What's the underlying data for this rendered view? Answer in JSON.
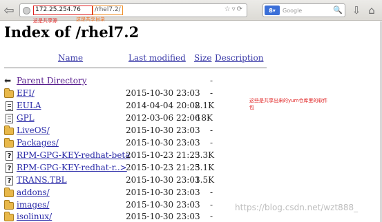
{
  "browser": {
    "url_host": "172.25.254.76",
    "url_path": "/rhel7.2/",
    "search_engine_badge": "8",
    "search_placeholder": "Google"
  },
  "annotations": {
    "host_note": "这是共享源",
    "path_note": "这是共享目录",
    "repo_note": "这些是共享出来的yum仓库里的软件包"
  },
  "page": {
    "title": "Index of /rhel7.2",
    "columns": {
      "name": "Name",
      "last_modified": "Last modified",
      "size": "Size",
      "description": "Description"
    },
    "rows": [
      {
        "icon": "back",
        "name": "Parent Directory",
        "modified": "",
        "size": "-"
      },
      {
        "icon": "folder",
        "name": "EFI/",
        "modified": "2015-10-30 23:03",
        "size": "-"
      },
      {
        "icon": "file",
        "name": "EULA",
        "modified": "2014-04-04 20:02",
        "size": "8.1K"
      },
      {
        "icon": "file",
        "name": "GPL",
        "modified": "2012-03-06 22:06",
        "size": "18K"
      },
      {
        "icon": "folder",
        "name": "LiveOS/",
        "modified": "2015-10-30 23:03",
        "size": "-"
      },
      {
        "icon": "folder",
        "name": "Packages/",
        "modified": "2015-10-30 23:03",
        "size": "-"
      },
      {
        "icon": "unknown",
        "name": "RPM-GPG-KEY-redhat-beta",
        "modified": "2015-10-23 21:25",
        "size": "3.3K"
      },
      {
        "icon": "unknown",
        "name": "RPM-GPG-KEY-redhat-r..>",
        "modified": "2015-10-23 21:25",
        "size": "3.1K"
      },
      {
        "icon": "unknown",
        "name": "TRANS.TBL",
        "modified": "2015-10-30 23:03",
        "size": "1.5K"
      },
      {
        "icon": "folder",
        "name": "addons/",
        "modified": "2015-10-30 23:03",
        "size": "-"
      },
      {
        "icon": "folder",
        "name": "images/",
        "modified": "2015-10-30 23:03",
        "size": "-"
      },
      {
        "icon": "folder",
        "name": "isolinux/",
        "modified": "2015-10-30 23:03",
        "size": "-"
      }
    ]
  },
  "watermark": "https://blog.csdn.net/wzt888_"
}
